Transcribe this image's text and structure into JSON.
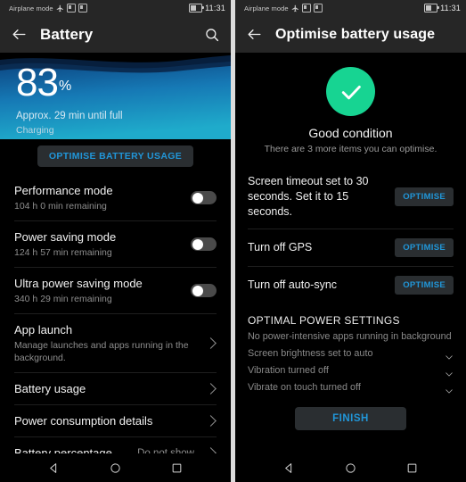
{
  "status_bar": {
    "airplane_label": "Airplane mode",
    "time": "11:31",
    "icons": [
      "airplane-icon",
      "sim-icon",
      "sd-card-icon",
      "battery-icon"
    ]
  },
  "left_screen": {
    "appbar": {
      "title": "Battery",
      "back_icon": "back-arrow-icon",
      "search_icon": "search-icon"
    },
    "hero": {
      "percent": "83",
      "percent_symbol": "%",
      "time_remaining": "Approx. 29 min until full",
      "charge_state": "Charging",
      "gradient_top": "#0b2c55",
      "gradient_bottom": "#1ba5c4"
    },
    "optimise_button": "OPTIMISE BATTERY USAGE",
    "toggle_rows": [
      {
        "title": "Performance mode",
        "subtitle": "104 h 0 min remaining",
        "on": false
      },
      {
        "title": "Power saving mode",
        "subtitle": "124 h 57 min remaining",
        "on": false
      },
      {
        "title": "Ultra power saving mode",
        "subtitle": "340 h 29 min remaining",
        "on": false
      }
    ],
    "nav_rows": [
      {
        "title": "App launch",
        "subtitle": "Manage launches and apps running in the background.",
        "value": ""
      },
      {
        "title": "Battery usage",
        "subtitle": "",
        "value": ""
      },
      {
        "title": "Power consumption details",
        "subtitle": "",
        "value": ""
      },
      {
        "title": "Battery percentage",
        "subtitle": "",
        "value": "Do not show"
      }
    ]
  },
  "right_screen": {
    "appbar": {
      "title": "Optimise battery usage",
      "back_icon": "back-arrow-icon"
    },
    "status": {
      "icon": "check-circle-icon",
      "icon_color": "#17d492",
      "title": "Good condition",
      "subtitle": "There are 3 more items you can optimise."
    },
    "optimise_rows": [
      {
        "label": "Screen timeout set to 30 seconds. Set it to 15 seconds.",
        "button": "OPTIMISE"
      },
      {
        "label": "Turn off GPS",
        "button": "OPTIMISE"
      },
      {
        "label": "Turn off auto-sync",
        "button": "OPTIMISE"
      }
    ],
    "optimal_section": {
      "heading": "OPTIMAL POWER SETTINGS",
      "items": [
        {
          "text": "No power-intensive apps running in background",
          "checked": false
        },
        {
          "text": "Screen brightness set to auto",
          "checked": true
        },
        {
          "text": "Vibration turned off",
          "checked": true
        },
        {
          "text": "Vibrate on touch turned off",
          "checked": true
        }
      ]
    },
    "finish_button": "FINISH"
  },
  "nav_bar": {
    "back": "nav-back-icon",
    "home": "nav-home-icon",
    "recents": "nav-recents-icon"
  },
  "accent_blue": "#2196d8"
}
